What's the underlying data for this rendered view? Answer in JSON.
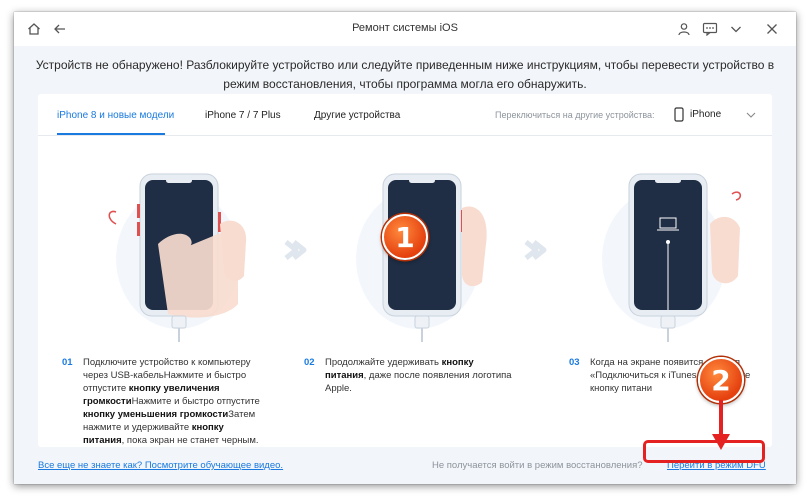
{
  "window": {
    "title": "Ремонт системы iOS",
    "instruction": "Устройств не обнаружено! Разблокируйте устройство или следуйте приведенным ниже инструкциям, чтобы перевести устройство в режим восстановления, чтобы программа могла его обнаружить."
  },
  "tabs": [
    {
      "label": "iPhone 8 и новые модели",
      "active": true
    },
    {
      "label": "iPhone 7 / 7 Plus",
      "active": false
    },
    {
      "label": "Другие устройства",
      "active": false
    }
  ],
  "device_switch": {
    "label": "Переключиться на другие устройства:",
    "selected": "iPhone"
  },
  "steps": [
    {
      "num": "01",
      "p1": "Подключите устройство к компьютеру через USB-кабельНажмите и быстро отпустите ",
      "b1": "кнопку увеличения громкости",
      "p2": "Нажмите и быстро отпустите ",
      "b2": "кнопку уменьшения громкости",
      "p3": "Затем нажмите и удерживайте ",
      "b3": "кнопку питания",
      "p4": ", пока экран не станет черным."
    },
    {
      "num": "02",
      "p1": "Продолжайте удерживать ",
      "b1": "кнопку питания",
      "p2": ", даже после появления логотипа Apple."
    },
    {
      "num": "03",
      "p1": "Когда на экране появится логотип «Подключиться к iTunes и",
      "p2": "отпустите кнопку питани"
    }
  ],
  "footer": {
    "help_link": "Все еще не знаете как? Посмотрите обучающее видео.",
    "question": "Не получается войти в режим восстановления?",
    "dfu_link": "Перейти в режим DFU"
  },
  "badges": {
    "one": "1",
    "two": "2"
  },
  "colors": {
    "accent": "#1a7ae0",
    "highlight": "#e52222",
    "badge": "#e5410f",
    "phone_screen": "#1f2e45"
  }
}
